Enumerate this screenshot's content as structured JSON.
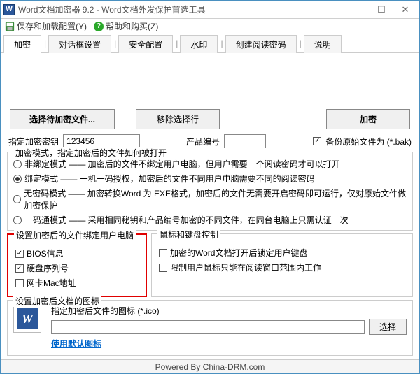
{
  "title": "Word文档加密器 9.2 - Word文档外发保护首选工具",
  "menu": {
    "save": "保存和加载配置(Y)",
    "help": "帮助和购买(Z)"
  },
  "tabs": [
    "加密",
    "对话框设置",
    "安全配置",
    "水印",
    "创建阅读密码",
    "说明"
  ],
  "buttons": {
    "select": "选择待加密文件...",
    "remove": "移除选择行",
    "encrypt": "加密",
    "browse": "选择"
  },
  "labels": {
    "key": "指定加密密钥",
    "product": "产品编号",
    "backup": "备份原始文件为 (*.bak)",
    "modeLegend": "加密模式，指定加密后的文件如何被打开",
    "bindLegend": "设置加密后的文件绑定用户电脑",
    "mouseLegend": "鼠标和键盘控制",
    "iconLegend": "设置加密后文档的图标",
    "iconPath": "指定加密后文件的图标 (*.ico)",
    "defaultIcon": "使用默认图标"
  },
  "values": {
    "key": "123456",
    "product": ""
  },
  "modes": [
    "非绑定模式 —— 加密后的文件不绑定用户电脑，但用户需要一个阅读密码才可以打开",
    "绑定模式  —— 一机一码授权，加密后的文件不同用户电脑需要不同的阅读密码",
    "无密码模式 —— 加密转换Word 为 EXE格式，加密后的文件无需要开启密码即可运行，仅对原始文件做加密保护",
    "一码通模式 —— 采用相同秘钥和产品编号加密的不同文件，在同台电脑上只需认证一次"
  ],
  "bind": {
    "bios": "BIOS信息",
    "hdd": "硬盘序列号",
    "mac": "网卡Mac地址"
  },
  "mouse": {
    "lock": "加密的Word文档打开后锁定用户键盘",
    "restrict": "限制用户鼠标只能在阅读窗口范围内工作"
  },
  "status": "Powered By China-DRM.com"
}
